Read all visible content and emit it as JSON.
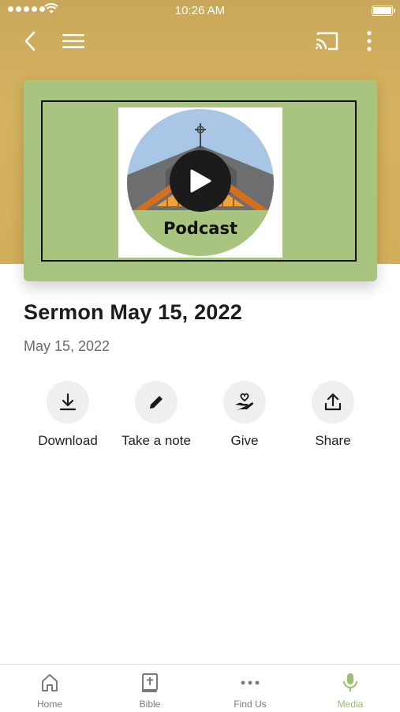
{
  "status_bar": {
    "time": "10:26 AM"
  },
  "hero": {
    "thumbnail_label": "Podcast"
  },
  "sermon": {
    "title": "Sermon May 15, 2022",
    "date": "May 15, 2022"
  },
  "actions": [
    {
      "label": "Download",
      "icon": "download-icon"
    },
    {
      "label": "Take a note",
      "icon": "pencil-icon"
    },
    {
      "label": "Give",
      "icon": "give-heart-hand-icon"
    },
    {
      "label": "Share",
      "icon": "share-icon"
    }
  ],
  "tabs": [
    {
      "label": "Home",
      "icon": "home-icon"
    },
    {
      "label": "Bible",
      "icon": "bible-icon"
    },
    {
      "label": "Find Us",
      "icon": "more-dots-icon"
    },
    {
      "label": "Media",
      "icon": "microphone-icon",
      "active": true
    }
  ],
  "colors": {
    "header": "#d3ae5a",
    "card": "#a8c47e",
    "active_tab": "#9cbf72"
  }
}
